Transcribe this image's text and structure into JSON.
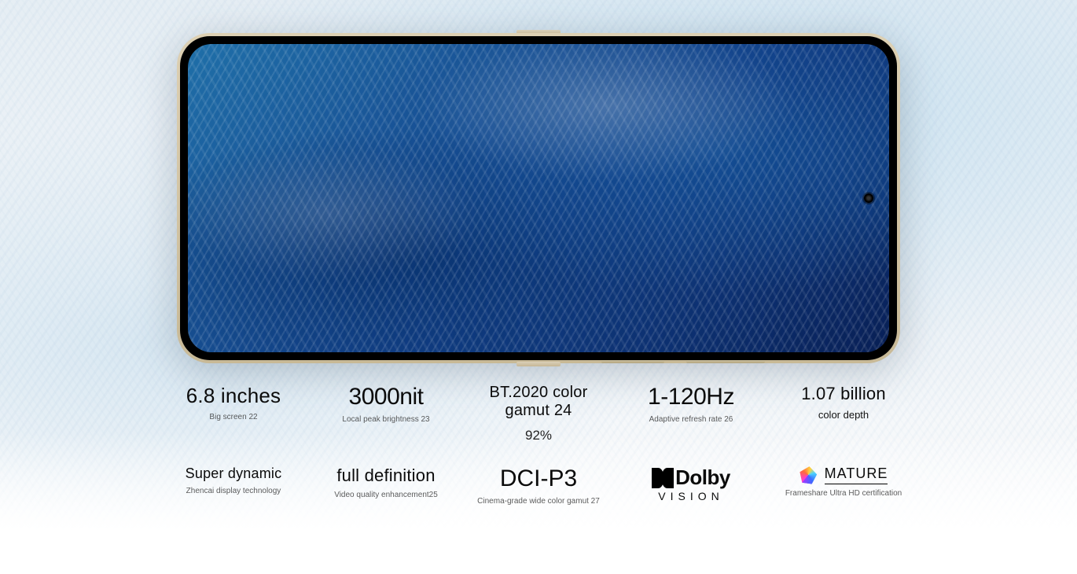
{
  "specs": {
    "row1": [
      {
        "stat": "6.8 inches",
        "big": false,
        "sub": "",
        "foot": "Big screen 22"
      },
      {
        "stat": "3000nit",
        "big": true,
        "sub": "",
        "foot": "Local peak brightness 23"
      },
      {
        "stat": "BT.2020 color gamut 24",
        "big": false,
        "sub": "92%",
        "foot": ""
      },
      {
        "stat": "1-120Hz",
        "big": true,
        "sub": "",
        "foot": "Adaptive refresh rate 26"
      },
      {
        "stat": "1.07 billion",
        "big": false,
        "sub": "",
        "foot": "color depth"
      }
    ],
    "row2": [
      {
        "stat": "Super dynamic",
        "big": false,
        "sub": "",
        "foot": "Zhencai display technology"
      },
      {
        "stat": "full definition",
        "big": false,
        "sub": "",
        "foot": "Video quality enhancement25"
      },
      {
        "stat": "DCI-P3",
        "big": true,
        "sub": "",
        "foot": "Cinema-grade wide color gamut 27"
      },
      {
        "type": "dolby",
        "brand": "Dolby",
        "label": "VISION"
      },
      {
        "type": "mature",
        "label": "MATURE",
        "foot": "Frameshare Ultra HD certification"
      }
    ]
  }
}
